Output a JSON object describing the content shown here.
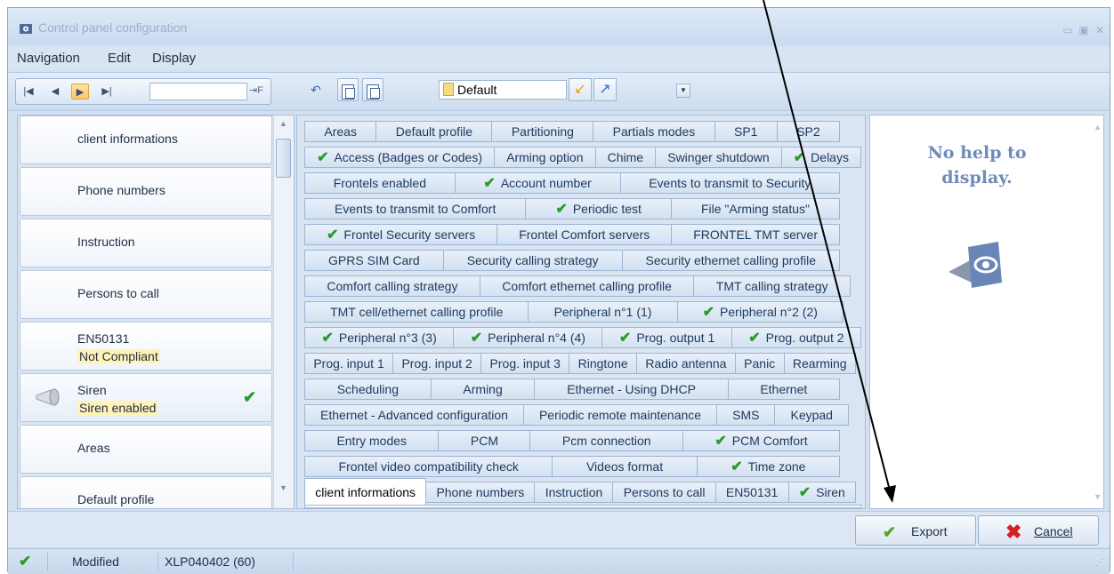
{
  "window": {
    "title": "Control panel configuration"
  },
  "menu": [
    "Navigation",
    "Edit",
    "Display"
  ],
  "toolbar": {
    "profile_value": "Default",
    "nav_go_label": "⇥F"
  },
  "left_nav": {
    "items": [
      {
        "label": "client informations",
        "sub": ""
      },
      {
        "label": "Phone numbers",
        "sub": ""
      },
      {
        "label": "Instruction",
        "sub": ""
      },
      {
        "label": "Persons to call",
        "sub": ""
      },
      {
        "label": "EN50131",
        "sub": "Not Compliant"
      },
      {
        "label": "Siren",
        "sub": "Siren enabled"
      },
      {
        "label": "Areas",
        "sub": ""
      },
      {
        "label": "Default profile",
        "sub": ""
      }
    ]
  },
  "tabs": {
    "rows": [
      [
        {
          "label": "Areas"
        },
        {
          "label": "Default profile"
        },
        {
          "label": "Partitioning"
        },
        {
          "label": "Partials modes"
        },
        {
          "label": "SP1"
        },
        {
          "label": "SP2"
        }
      ],
      [
        {
          "label": "Access (Badges or Codes)",
          "check": true
        },
        {
          "label": "Arming option"
        },
        {
          "label": "Chime"
        },
        {
          "label": "Swinger shutdown"
        },
        {
          "label": "Delays",
          "check": true
        }
      ],
      [
        {
          "label": "Frontels enabled"
        },
        {
          "label": "Account number",
          "check": true
        },
        {
          "label": "Events to transmit to Security"
        }
      ],
      [
        {
          "label": "Events to transmit to Comfort"
        },
        {
          "label": "Periodic test",
          "check": true
        },
        {
          "label": "File \"Arming status\""
        }
      ],
      [
        {
          "label": "Frontel Security servers",
          "check": true
        },
        {
          "label": "Frontel Comfort servers"
        },
        {
          "label": "FRONTEL TMT server"
        }
      ],
      [
        {
          "label": "GPRS SIM Card"
        },
        {
          "label": "Security calling strategy"
        },
        {
          "label": "Security ethernet calling profile"
        }
      ],
      [
        {
          "label": "Comfort calling strategy"
        },
        {
          "label": "Comfort ethernet calling profile"
        },
        {
          "label": "TMT calling strategy"
        }
      ],
      [
        {
          "label": "TMT cell/ethernet calling profile"
        },
        {
          "label": "Peripheral n°1 (1)"
        },
        {
          "label": "Peripheral n°2 (2)",
          "check": true
        }
      ],
      [
        {
          "label": "Peripheral n°3 (3)",
          "check": true
        },
        {
          "label": "Peripheral n°4 (4)",
          "check": true
        },
        {
          "label": "Prog. output 1",
          "check": true
        },
        {
          "label": "Prog. output 2",
          "check": true
        }
      ],
      [
        {
          "label": "Prog. input 1"
        },
        {
          "label": "Prog. input 2"
        },
        {
          "label": "Prog. input 3"
        },
        {
          "label": "Ringtone"
        },
        {
          "label": "Radio antenna"
        },
        {
          "label": "Panic"
        },
        {
          "label": "Rearming"
        }
      ],
      [
        {
          "label": "Scheduling"
        },
        {
          "label": "Arming"
        },
        {
          "label": "Ethernet - Using DHCP"
        },
        {
          "label": "Ethernet"
        }
      ],
      [
        {
          "label": "Ethernet - Advanced configuration"
        },
        {
          "label": "Periodic remote maintenance"
        },
        {
          "label": "SMS"
        },
        {
          "label": "Keypad"
        }
      ],
      [
        {
          "label": "Entry modes"
        },
        {
          "label": "PCM"
        },
        {
          "label": "Pcm connection"
        },
        {
          "label": "PCM Comfort",
          "check": true
        }
      ],
      [
        {
          "label": "Frontel video compatibility check"
        },
        {
          "label": "Videos format"
        },
        {
          "label": "Time zone",
          "check": true
        }
      ],
      [
        {
          "label": "client informations",
          "active": true
        },
        {
          "label": "Phone numbers"
        },
        {
          "label": "Instruction"
        },
        {
          "label": "Persons to call"
        },
        {
          "label": "EN50131"
        },
        {
          "label": "Siren",
          "check": true
        }
      ]
    ]
  },
  "help": {
    "text": "No help to display."
  },
  "buttons": {
    "export": "Export",
    "cancel": "Cancel"
  },
  "status": {
    "state": "Modified",
    "device": "XLP040402 (60)"
  },
  "colors": {
    "check": "#2a9a2a",
    "help_text": "#6e8cb9",
    "accent": "#d3e0f0"
  }
}
